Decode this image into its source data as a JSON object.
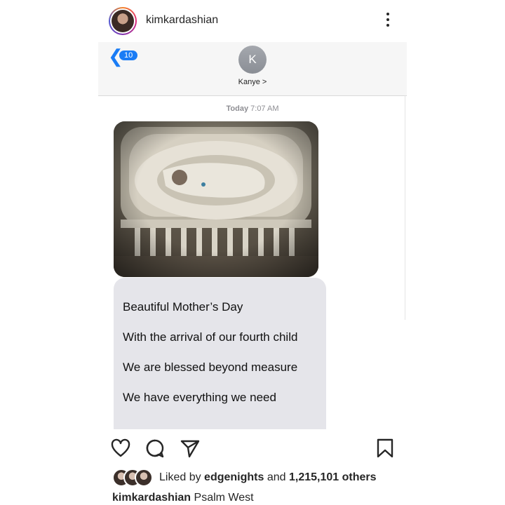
{
  "post": {
    "username": "kimkardashian",
    "icons": {
      "avatar": "profile-avatar",
      "more": "more-options-icon"
    }
  },
  "imessage": {
    "back_count": "10",
    "contact_initial": "K",
    "contact_name": "Kanye >",
    "timestamp_day": "Today",
    "timestamp_time": "7:07 AM",
    "photo_description_icon": "baby-in-bassinet-photo",
    "message_lines": [
      "Beautiful Mother’s Day",
      "With the arrival of our fourth child",
      "We are blessed beyond measure",
      "We have everything we need"
    ],
    "colors": {
      "accent": "#1a7cf5",
      "bubble": "#e5e5ea"
    }
  },
  "actions": {
    "icons": [
      "heart-icon",
      "comment-icon",
      "share-icon",
      "bookmark-icon"
    ]
  },
  "likes": {
    "prefix": "Liked by",
    "first_user": "edgenights",
    "conjunction": "and",
    "others": "1,215,101 others"
  },
  "caption": {
    "username": "kimkardashian",
    "text": "Psalm West"
  }
}
